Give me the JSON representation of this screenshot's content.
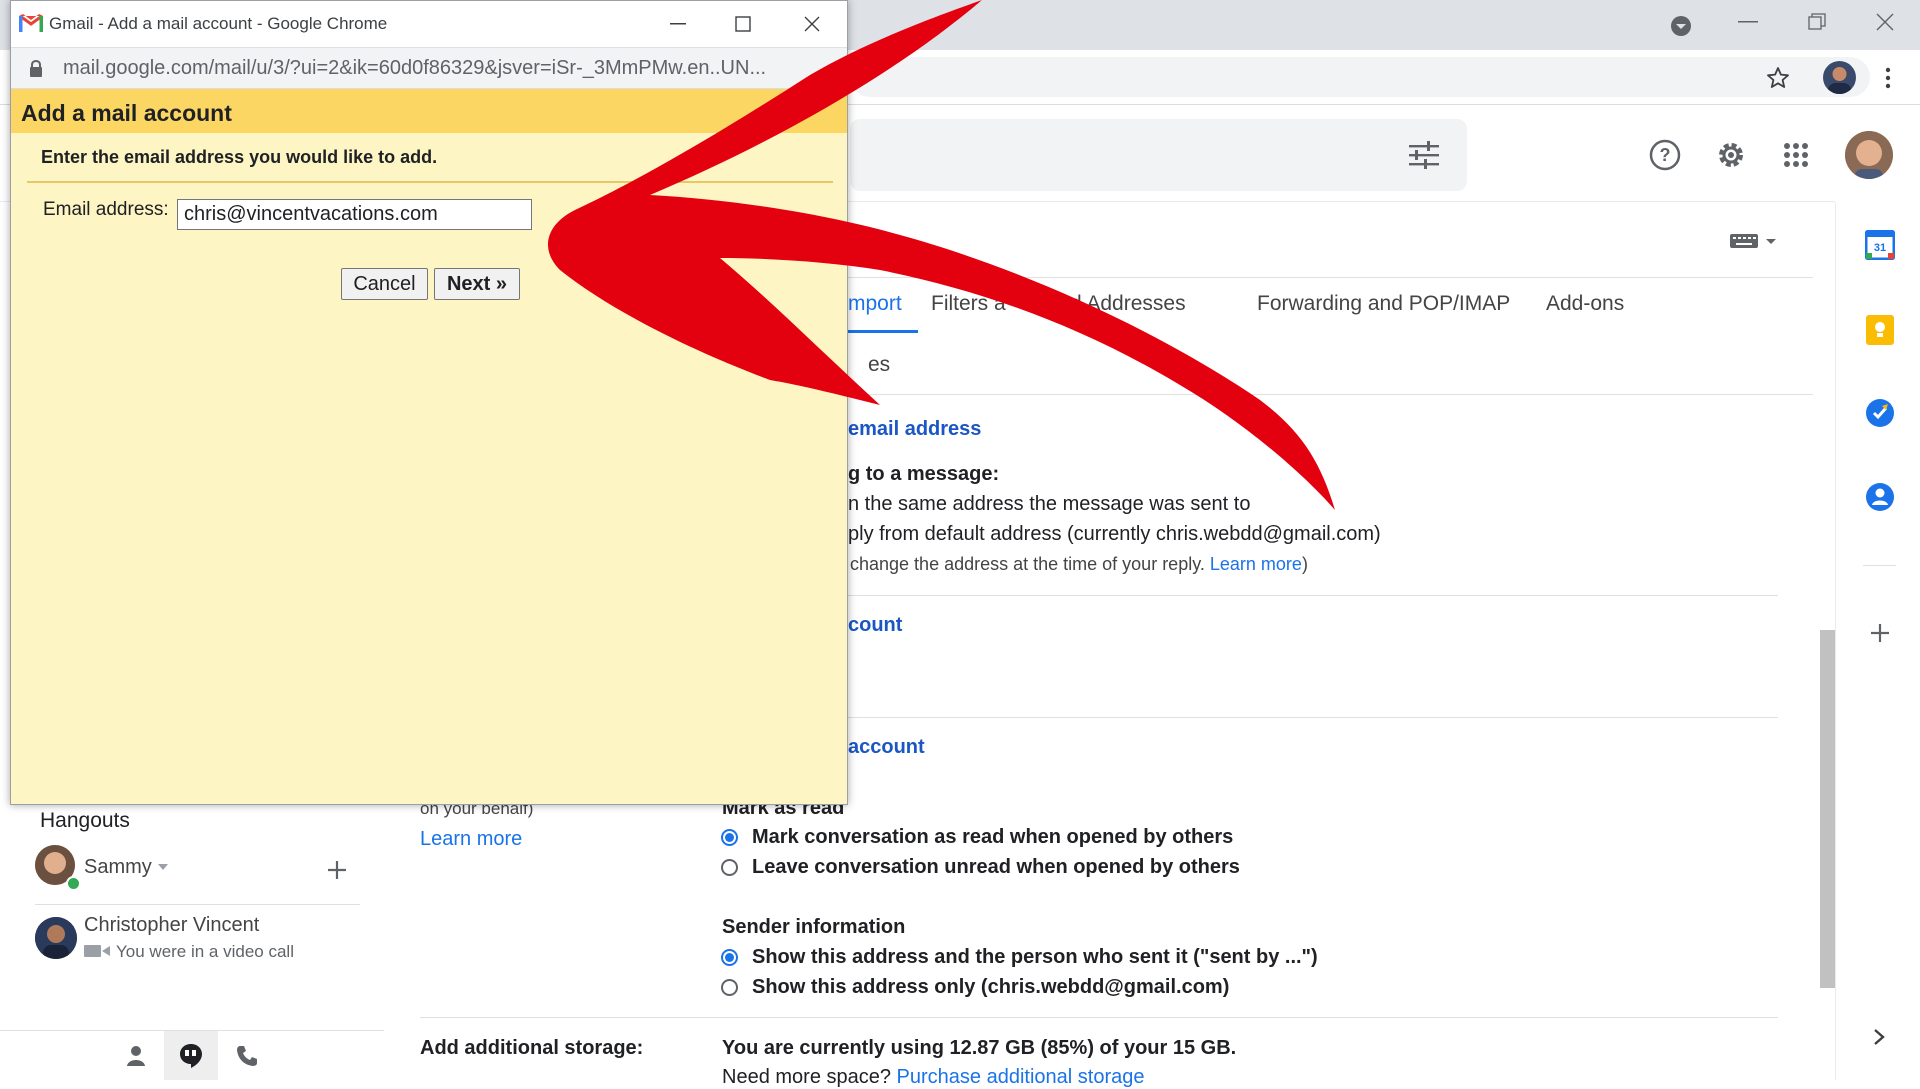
{
  "popup": {
    "window_title": "Gmail - Add a mail account - Google Chrome",
    "url": "mail.google.com/mail/u/3/?ui=2&ik=60d0f86329&jsver=iSr-_3MmPMw.en..UN...",
    "header": "Add a mail account",
    "instruction": "Enter the email address you would like to add.",
    "email_label": "Email address:",
    "email_value": "chris@vincentvacations.com",
    "cancel_label": "Cancel",
    "next_label": "Next »"
  },
  "settings": {
    "tabs": [
      "mport",
      "Filters a",
      "d Addresses",
      "Forwarding and POP/IMAP",
      "Add-ons"
    ],
    "subtab_fragment": "es",
    "send_mail_as_link": "email address",
    "reply_heading": "g to a message:",
    "reply_option_1": "n the same address the message was sent to",
    "reply_option_2": "ply from default address (currently chris.webdd@gmail.com)",
    "reply_note": "change the address at the time of your reply.",
    "reply_note_link": "Learn more",
    "reply_note_close": ")",
    "check_mail_link": "count",
    "grant_access_link": "account",
    "grant_note": "on your behalf)",
    "learn_more": "Learn more",
    "mark_as_read_heading": "Mark as read",
    "mark_option_1": "Mark conversation as read when opened by others",
    "mark_option_2": "Leave conversation unread when opened by others",
    "sender_info_heading": "Sender information",
    "sender_option_1": "Show this address and the person who sent it (\"sent by ...\")",
    "sender_option_2": "Show this address only (chris.webdd@gmail.com)",
    "storage_label": "Add additional storage:",
    "storage_value": "You are currently using 12.87 GB (85%) of your 15 GB.",
    "storage_more_prefix": "Need more space?",
    "storage_more_link": "Purchase additional storage"
  },
  "hangouts": {
    "title": "Hangouts",
    "self_name": "Sammy",
    "contact_name": "Christopher Vincent",
    "contact_status": "You were in a video call"
  },
  "calendar_day": "31",
  "colors": {
    "popup_header": "#fcd663",
    "popup_body": "#fef5c4",
    "link_blue": "#1a73e8",
    "arrow_red": "#e3000f"
  }
}
